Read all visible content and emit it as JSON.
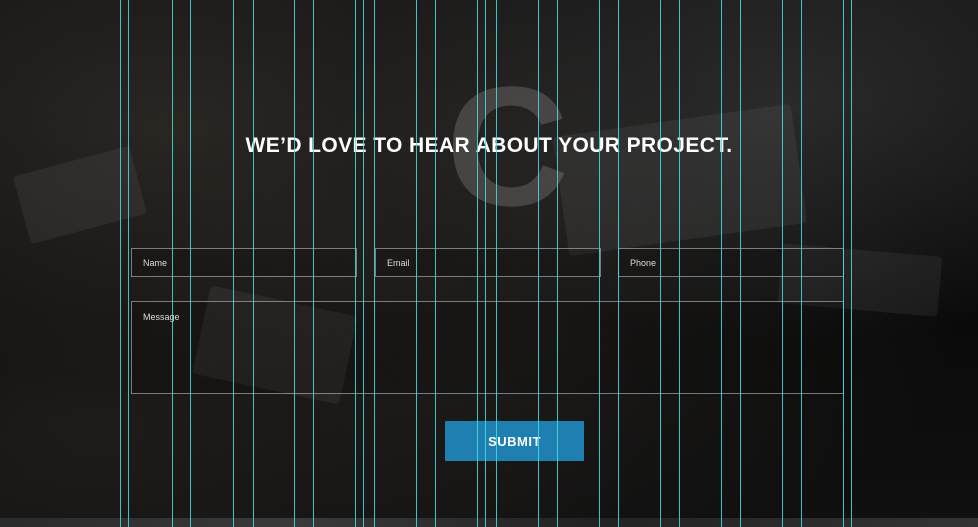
{
  "page": {
    "heading": "WE’D LOVE TO HEAR ABOUT YOUR PROJECT.",
    "watermark_letter": "C"
  },
  "form": {
    "name_placeholder": "Name",
    "email_placeholder": "Email",
    "phone_placeholder": "Phone",
    "message_placeholder": "Message",
    "submit_label": "SUBMIT"
  },
  "colors": {
    "submit_button": "#1e7fb0",
    "guide_lines": "#40e0e6",
    "heading_text": "#ffffff"
  }
}
